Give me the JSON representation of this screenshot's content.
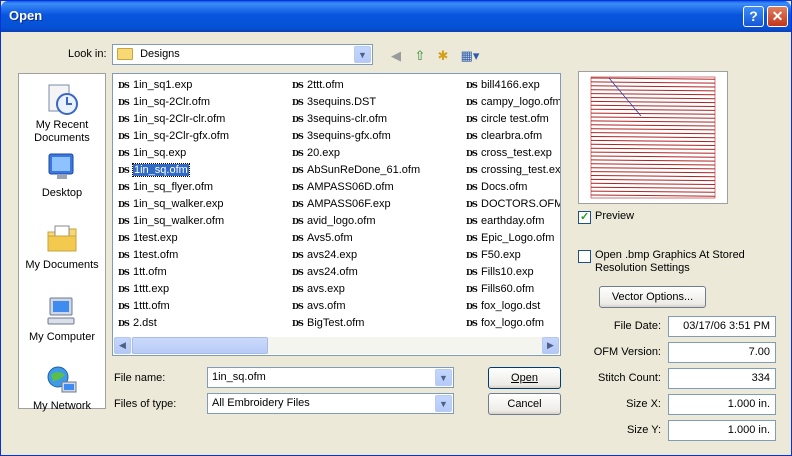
{
  "window": {
    "title": "Open",
    "help_glyph": "?",
    "close_glyph": "✕"
  },
  "look_in": {
    "label": "Look in:",
    "value": "Designs"
  },
  "places": [
    {
      "name": "my-recent-documents",
      "label": "My Recent Documents"
    },
    {
      "name": "desktop",
      "label": "Desktop"
    },
    {
      "name": "my-documents",
      "label": "My Documents"
    },
    {
      "name": "my-computer",
      "label": "My Computer"
    },
    {
      "name": "my-network",
      "label": "My Network"
    }
  ],
  "files": {
    "icon_text": "DS",
    "col1": [
      "1in_sq1.exp",
      "1in_sq-2Clr.ofm",
      "1in_sq-2Clr-clr.ofm",
      "1in_sq-2Clr-gfx.ofm",
      "1in_sq.exp",
      "1in_sq.ofm",
      "1in_sq_flyer.ofm",
      "1in_sq_walker.exp",
      "1in_sq_walker.ofm",
      "1test.exp",
      "1test.ofm",
      "1tt.ofm",
      "1ttt.exp",
      "1ttt.ofm",
      "2.dst"
    ],
    "col2": [
      "2ttt.ofm",
      "3sequins.DST",
      "3sequins-clr.ofm",
      "3sequins-gfx.ofm",
      "20.exp",
      "AbSunReDone_61.ofm",
      "AMPASS06D.ofm",
      "AMPASS06F.exp",
      "avid_logo.ofm",
      "Avs5.ofm",
      "avs24.exp",
      "avs24.ofm",
      "avs.exp",
      "avs.ofm",
      "BigTest.ofm"
    ],
    "col3": [
      "bill4166.exp",
      "campy_logo.ofm",
      "circle test.ofm",
      "clearbra.ofm",
      "cross_test.exp",
      "crossing_test.exp",
      "Docs.ofm",
      "DOCTORS.OFM",
      "earthday.ofm",
      "Epic_Logo.ofm",
      "F50.exp",
      "Fills10.exp",
      "Fills60.ofm",
      "fox_logo.dst",
      "fox_logo.ofm"
    ],
    "selected": "1in_sq.ofm"
  },
  "file_name": {
    "label": "File name:",
    "value": "1in_sq.ofm"
  },
  "files_of_type": {
    "label": "Files of type:",
    "value": "All Embroidery Files"
  },
  "buttons": {
    "open": "Open",
    "cancel": "Cancel",
    "vector_options": "Vector Options..."
  },
  "preview_checkbox": {
    "label": "Preview",
    "checked": true
  },
  "bmp_checkbox": {
    "label_line1": "Open .bmp Graphics At Stored",
    "label_line2": "Resolution Settings",
    "checked": false
  },
  "info": {
    "file_date_label": "File Date:",
    "file_date": "03/17/06 3:51 PM",
    "ofm_version_label": "OFM Version:",
    "ofm_version": "7.00",
    "stitch_count_label": "Stitch Count:",
    "stitch_count": "334",
    "size_x_label": "Size X:",
    "size_x": "1.000 in.",
    "size_y_label": "Size Y:",
    "size_y": "1.000 in."
  },
  "colors": {
    "title_bar": "#0855DD",
    "selection": "#316AC5",
    "preview_stitch": "#B22222"
  },
  "scrollbar": {
    "left_glyph": "◀",
    "right_glyph": "▶"
  },
  "toolbar": {
    "back_glyph": "◀",
    "up_glyph": "⇧",
    "new_folder_glyph": "✱",
    "views_glyph": "▦▾"
  },
  "combo_arrow_glyph": "▼"
}
